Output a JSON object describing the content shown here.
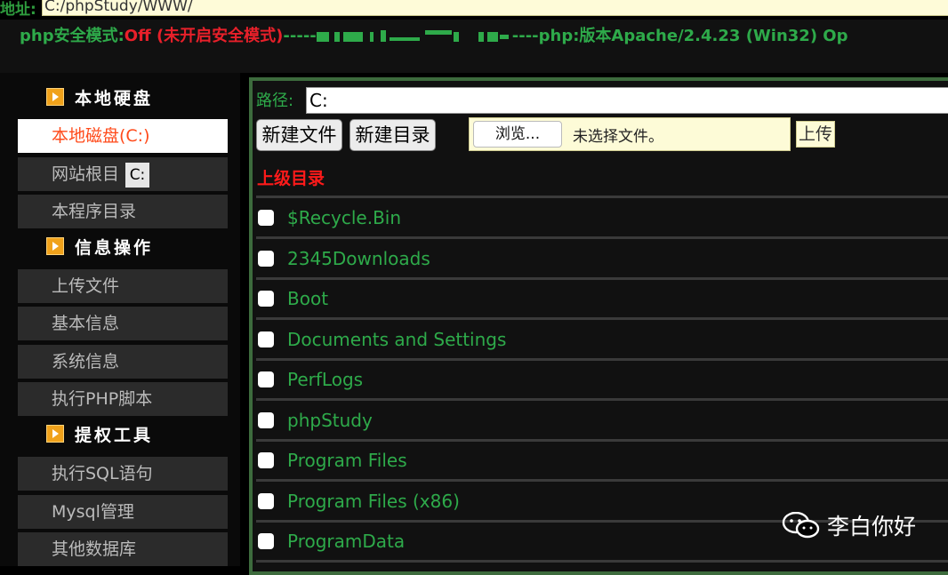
{
  "address": {
    "label": "地址:",
    "value": "C:/phpStudy/WWW/"
  },
  "status": {
    "seg1": "php安全模式:",
    "seg2": "Off (未开启安全模式)",
    "seg3": "-----",
    "seg4": "----php:版本Apache/2.4.23 (Win32) Op"
  },
  "sidebar": {
    "sections": [
      {
        "title": "本地硬盘",
        "items": [
          "本地磁盘(C:)",
          "网站根目",
          "本程序目录"
        ]
      },
      {
        "title": "信息操作",
        "items": [
          "上传文件",
          "基本信息",
          "系统信息",
          "执行PHP脚本"
        ]
      },
      {
        "title": "提权工具",
        "items": [
          "执行SQL语句",
          "Mysql管理",
          "其他数据库"
        ]
      }
    ],
    "tooltip": "C:"
  },
  "main": {
    "path_label": "路径:",
    "path_value": "C:",
    "new_file": "新建文件",
    "new_dir": "新建目录",
    "browse": "浏览...",
    "no_file": "未选择文件。",
    "upload": "上传",
    "parent_dir": "上级目录",
    "files": [
      "$Recycle.Bin",
      "2345Downloads",
      "Boot",
      "Documents and Settings",
      "PerfLogs",
      "phpStudy",
      "Program Files",
      "Program Files (x86)",
      "ProgramData"
    ]
  },
  "watermark": {
    "text": "李白你好",
    "icon": "wechat-icon"
  },
  "colors": {
    "green": "#2eaa4a",
    "red": "#e8202a",
    "accent_orange": "#ff4a1a"
  }
}
